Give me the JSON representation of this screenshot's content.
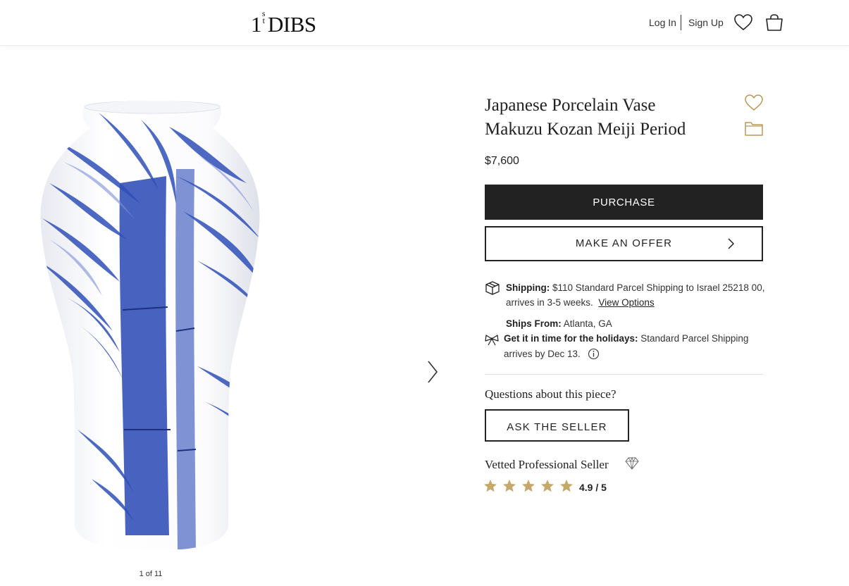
{
  "header": {
    "logo": {
      "num": "1",
      "sup_top": "s",
      "sup_bottom": "t",
      "word": "DIBS"
    },
    "login": "Log In",
    "signup": "Sign Up"
  },
  "gallery": {
    "counter": "1 of 11"
  },
  "product": {
    "title_line1": "Japanese Porcelain Vase",
    "title_line2": "Makuzu Kozan Meiji Period",
    "price": "$7,600",
    "purchase_label": "PURCHASE",
    "offer_label": "MAKE AN OFFER"
  },
  "shipping": {
    "label": "Shipping:",
    "text": " $110 Standard Parcel Shipping to Israel 25218 00, arrives in 3-5 weeks.",
    "link": "View Options",
    "from_label": "Ships From:",
    "from_value": " Atlanta, GA",
    "holiday_label": "Get it in time for the holidays:",
    "holiday_text": " Standard Parcel Shipping arrives by Dec 13."
  },
  "seller": {
    "questions": "Questions about this piece?",
    "ask_label": "ASK THE SELLER",
    "vetted": "Vetted Professional Seller",
    "rating": "4.9 / 5",
    "rating_value": 4.9,
    "rating_max": 5
  },
  "colors": {
    "accent_gold": "#b8985a",
    "star_gold": "#c6a86a",
    "vase_blue": "#2f4fb8"
  }
}
